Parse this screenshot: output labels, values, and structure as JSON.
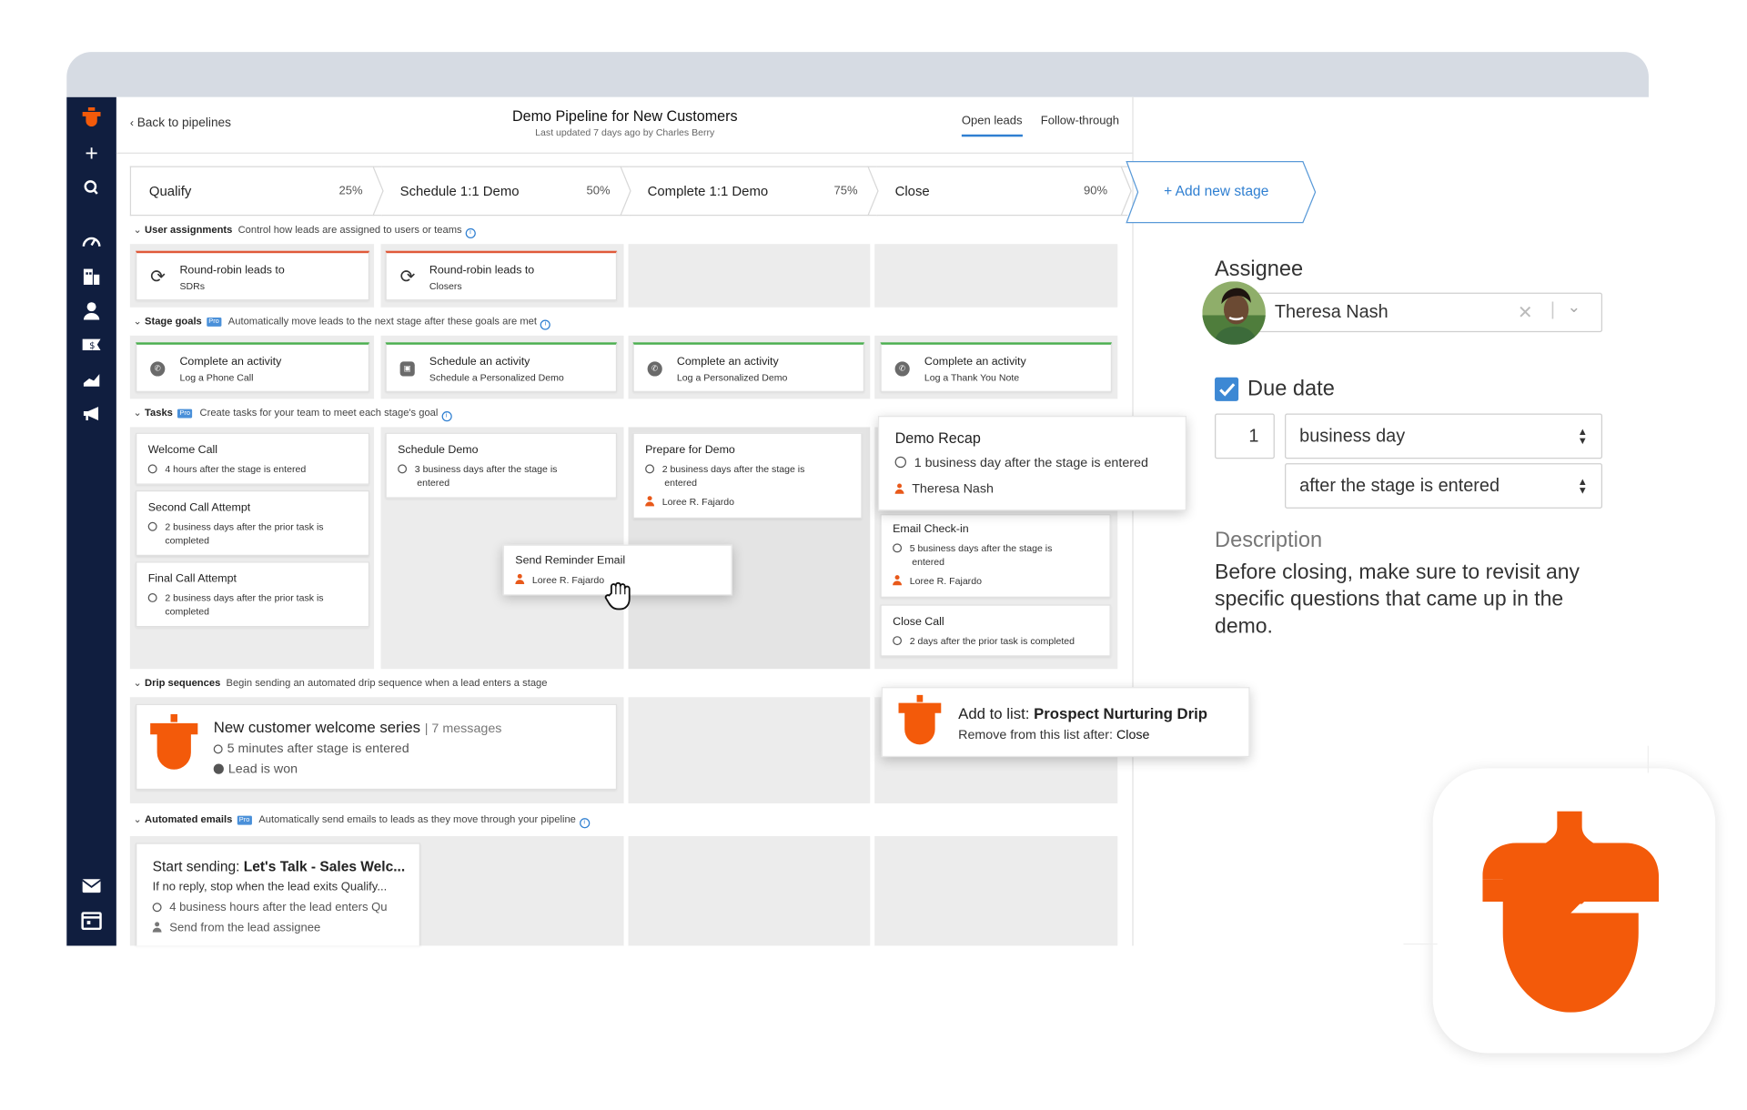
{
  "header": {
    "back_label": "Back to pipelines",
    "title": "Demo Pipeline for New Customers",
    "subtitle": "Last updated 7 days ago by Charles Berry",
    "tabs": [
      {
        "label": "Open leads",
        "active": true
      },
      {
        "label": "Follow-through",
        "active": false
      }
    ]
  },
  "stages": [
    {
      "name": "Qualify",
      "percent": "25%"
    },
    {
      "name": "Schedule 1:1 Demo",
      "percent": "50%"
    },
    {
      "name": "Complete 1:1 Demo",
      "percent": "75%"
    },
    {
      "name": "Close",
      "percent": "90%"
    }
  ],
  "add_stage_label": "+ Add new stage",
  "sections": {
    "user_assignments": {
      "title": "User assignments",
      "desc": "Control how leads are assigned to users or teams"
    },
    "stage_goals": {
      "title": "Stage goals",
      "badge": "Pro",
      "desc": "Automatically move leads to the next stage after these goals are met"
    },
    "tasks": {
      "title": "Tasks",
      "badge": "Pro",
      "desc": "Create tasks for your team to meet each stage's goal"
    },
    "drip": {
      "title": "Drip sequences",
      "desc": "Begin sending an automated drip sequence when a lead enters a stage"
    },
    "emails": {
      "title": "Automated emails",
      "badge": "Pro",
      "desc": "Automatically send emails to leads as they move through your pipeline"
    }
  },
  "assignments": [
    {
      "title": "Round-robin leads to",
      "sub": "SDRs"
    },
    {
      "title": "Round-robin leads to",
      "sub": "Closers"
    }
  ],
  "goals": [
    {
      "title": "Complete an activity",
      "sub": "Log a Phone Call"
    },
    {
      "title": "Schedule an activity",
      "sub": "Schedule a Personalized Demo"
    },
    {
      "title": "Complete an activity",
      "sub": "Log a Personalized Demo"
    },
    {
      "title": "Complete an activity",
      "sub": "Log a Thank You Note"
    }
  ],
  "tasks": {
    "welcome": {
      "title": "Welcome Call",
      "sub": "4 hours after the stage is entered"
    },
    "second": {
      "title": "Second Call Attempt",
      "sub1": "2 business days after the prior task is",
      "sub2": "completed"
    },
    "final": {
      "title": "Final Call Attempt",
      "sub1": "2 business days after the prior task is",
      "sub2": "completed"
    },
    "schedule": {
      "title": "Schedule Demo",
      "sub1": "3 business days after the stage is",
      "sub2": "entered"
    },
    "prepare": {
      "title": "Prepare for Demo",
      "sub1": "2 business days after the stage is",
      "sub2": "entered",
      "user": "Loree R. Fajardo"
    },
    "reminder": {
      "title": "Send Reminder Email",
      "user": "Loree R. Fajardo"
    },
    "recap": {
      "title": "Demo Recap",
      "sub": "1 business day after the stage is entered",
      "user": "Theresa Nash"
    },
    "checkin": {
      "title": "Email Check-in",
      "sub1": "5 business days after the stage is",
      "sub2": "entered",
      "user": "Loree R. Fajardo"
    },
    "closecall": {
      "title": "Close Call",
      "sub": "2 days after the prior task is completed"
    }
  },
  "drip": {
    "title": "New customer welcome series",
    "count": "| 7 messages",
    "l1": "5 minutes after stage is entered",
    "l2": "Lead is won",
    "list_prefix": "Add to list: ",
    "list_name": "Prospect Nurturing Drip",
    "remove_prefix": "Remove from this list after: ",
    "remove_stage": "Close"
  },
  "email": {
    "title_prefix": "Start sending: ",
    "title_name": "Let's Talk - Sales Welc...",
    "l1": "If no reply, stop when the lead exits Qualify...",
    "l2": "4 business hours after the lead enters Qu",
    "l3": "Send from the lead assignee"
  },
  "panel": {
    "assignee_label": "Assignee",
    "assignee_name": "Theresa Nash",
    "due_label": "Due date",
    "due_checked": true,
    "due_number": "1",
    "due_unit": "business day",
    "due_when": "after the stage is entered",
    "desc_label": "Description",
    "desc_text": "Before closing, make sure to revisit any specific questions that came up in the demo."
  },
  "colors": {
    "brand": "#f35a0a",
    "sidebar": "#101e3f",
    "link": "#2f7fd1",
    "check": "#3d88d4"
  }
}
